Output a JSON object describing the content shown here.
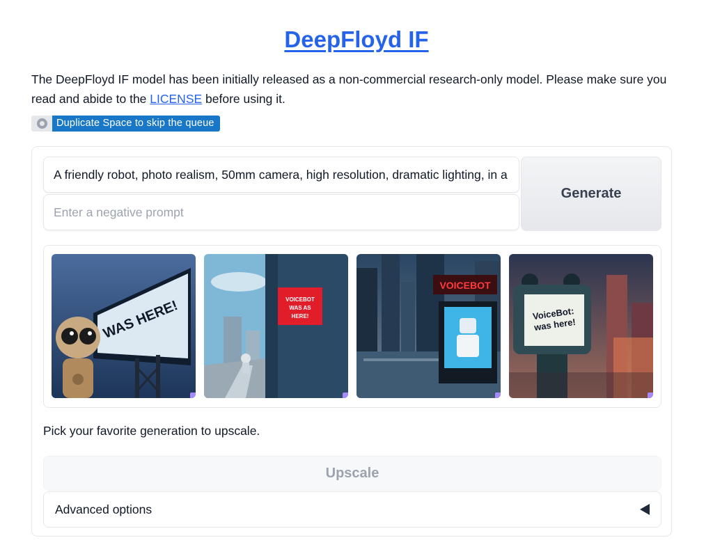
{
  "header": {
    "title": "DeepFloyd IF"
  },
  "intro": {
    "text_before": "The DeepFloyd IF model has been initially released as a non-commercial research-only model. Please make sure you read and abide to the ",
    "link": "LICENSE",
    "text_after": " before using it."
  },
  "duplicate_badge": {
    "label": "Duplicate Space to skip the queue",
    "icon": "duplicate-icon"
  },
  "prompt": {
    "value": "A friendly robot, photo realism, 50mm camera, high resolution, dramatic lighting, in a"
  },
  "negative_prompt": {
    "value": "",
    "placeholder": "Enter a negative prompt"
  },
  "generate_button": {
    "label": "Generate"
  },
  "gallery": {
    "images": [
      {
        "text": "WAS HERE!"
      },
      {
        "text": "VOICEBOT WAS AS HERE!"
      },
      {
        "text": "VOICEBOT"
      },
      {
        "text": "VoiceBot was here!"
      }
    ]
  },
  "pick_text": "Pick your favorite generation to upscale.",
  "upscale_button": {
    "label": "Upscale",
    "disabled": true
  },
  "advanced_options": {
    "label": "Advanced options",
    "icon": "caret-left-icon"
  },
  "colors": {
    "accent": "#2563eb",
    "badge": "#1877c6",
    "text": "#111827"
  }
}
